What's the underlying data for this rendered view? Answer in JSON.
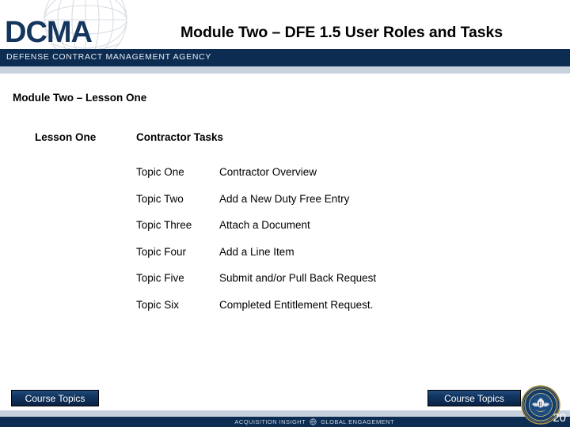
{
  "header": {
    "logo_wordmark": "DCMA",
    "agency_name": "DEFENSE CONTRACT MANAGEMENT AGENCY",
    "title": "Module Two – DFE 1.5 User Roles and Tasks",
    "globe_icon": "globe-wireframe-icon"
  },
  "body": {
    "lesson_heading": "Module Two – Lesson One",
    "subhead_left": "Lesson One",
    "subhead_right": "Contractor Tasks",
    "topics": [
      {
        "label": "Topic One",
        "desc": "Contractor Overview"
      },
      {
        "label": "Topic Two",
        "desc": "Add a New Duty Free Entry"
      },
      {
        "label": "Topic Three",
        "desc": "Attach a Document"
      },
      {
        "label": "Topic Four",
        "desc": "Add a Line Item"
      },
      {
        "label": "Topic Five",
        "desc": "Submit and/or Pull Back Request"
      },
      {
        "label": "Topic Six",
        "desc": "Completed Entitlement Request."
      }
    ]
  },
  "footer": {
    "course_topics_left_label": "Course Topics",
    "course_topics_right_label": "Course Topics",
    "tagline_left": "ACQUISITION INSIGHT",
    "tagline_right": "GLOBAL ENGAGEMENT",
    "tagline_icon": "globe-icon",
    "seal_icon": "dcma-seal-icon",
    "page_number": "20"
  },
  "colors": {
    "navy": "#0c2c52",
    "light_rule": "#c8d2de",
    "logo_navy": "#13355e",
    "text": "#000000",
    "button_text": "#ffffff"
  }
}
